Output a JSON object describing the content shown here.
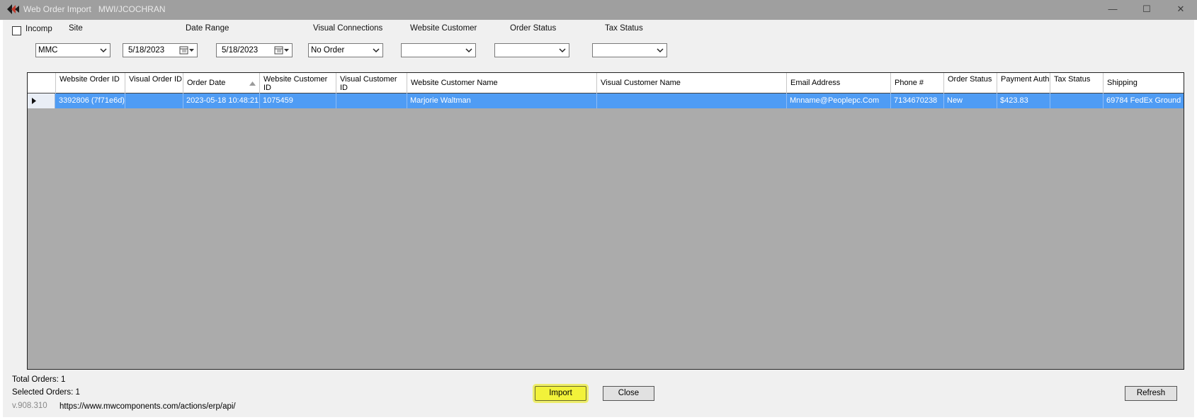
{
  "window": {
    "title": "Web Order Import",
    "user": "MWI/JCOCHRAN",
    "min_glyph": "—",
    "max_glyph": "☐",
    "close_glyph": "✕"
  },
  "filters": {
    "incomplete_label": "Incomp",
    "incomplete_checked": false,
    "site_label": "Site",
    "site_value": "MMC",
    "date_range_label": "Date Range",
    "date_from": "5/18/2023",
    "date_to": "5/18/2023",
    "visual_connections_label": "Visual Connections",
    "visual_connections_value": "No Order",
    "website_customer_label": "Website Customer",
    "website_customer_value": "",
    "order_status_label": "Order Status",
    "order_status_value": "",
    "tax_status_label": "Tax Status",
    "tax_status_value": ""
  },
  "grid": {
    "columns": [
      "Website Order ID",
      "Visual Order ID",
      "Order Date",
      "Website Customer ID",
      "Visual Customer ID",
      "Website Customer Name",
      "Visual Customer Name",
      "Email Address",
      "Phone #",
      "Order Status",
      "Payment Auth",
      "Tax Status",
      "Shipping"
    ],
    "sorted_column": "Order Date",
    "rows": [
      {
        "selected": true,
        "cells": [
          "3392806 (7f71e6d)",
          "",
          "2023-05-18 10:48:21",
          "1075459",
          "",
          "Marjorie Waltman",
          "",
          "Mnname@Peoplepc.Com",
          "7134670238",
          "New",
          "$423.83",
          "",
          "69784 FedEx Ground"
        ]
      }
    ]
  },
  "footer": {
    "total_orders": "Total Orders: 1",
    "selected_orders": "Selected Orders: 1",
    "version": "v.908.310",
    "api_url": "https://www.mwcomponents.com/actions/erp/api/",
    "import_label": "Import",
    "close_label": "Close",
    "refresh_label": "Refresh"
  },
  "colors": {
    "selection": "#4f9cf4",
    "grid_background": "#ababab",
    "titlebar": "#9f9f9f",
    "import_highlight": "#f2f23a"
  }
}
